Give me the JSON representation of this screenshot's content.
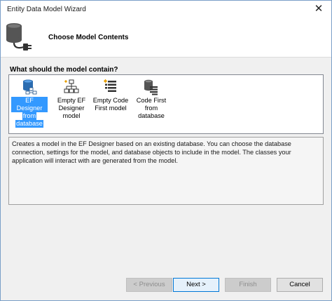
{
  "window": {
    "title": "Entity Data Model Wizard",
    "close_glyph": "✕"
  },
  "header": {
    "title": "Choose Model Contents",
    "icon": "database-plug-icon"
  },
  "question": "What should the model contain?",
  "options": [
    {
      "label": "EF Designer from database",
      "lines": [
        "EF Designer",
        "from",
        "database"
      ],
      "icon": "ef-designer-database-icon",
      "selected": true
    },
    {
      "label": "Empty EF Designer model",
      "lines": [
        "Empty EF",
        "Designer",
        "model"
      ],
      "icon": "empty-designer-model-icon",
      "selected": false
    },
    {
      "label": "Empty Code First model",
      "lines": [
        "Empty Code",
        "First model"
      ],
      "icon": "empty-code-first-icon",
      "selected": false
    },
    {
      "label": "Code First from database",
      "lines": [
        "Code First",
        "from",
        "database"
      ],
      "icon": "code-first-database-icon",
      "selected": false
    }
  ],
  "description": "Creates a model in the EF Designer based on an existing database. You can choose the database connection, settings for the model, and database objects to include in the model. The classes your application will interact with are generated from the model.",
  "buttons": {
    "previous": "< Previous",
    "next": "Next >",
    "finish": "Finish",
    "cancel": "Cancel"
  },
  "colors": {
    "selection": "#3399ff",
    "accent_border": "#0078d7"
  }
}
